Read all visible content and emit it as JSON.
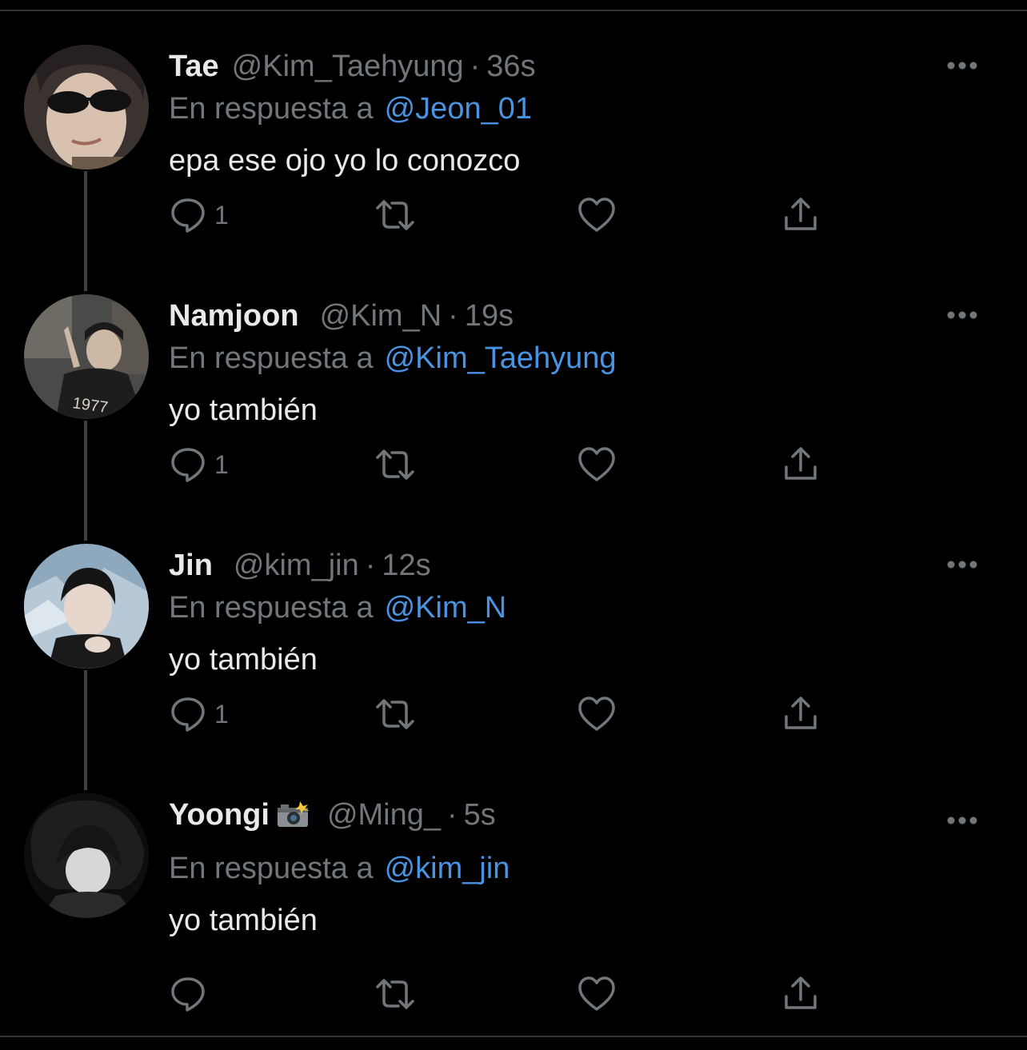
{
  "tweets": [
    {
      "name": "Tae",
      "handle": "@Kim_Taehyung",
      "dot": "·",
      "time": "36s",
      "reply_prefix": "En respuesta a",
      "reply_to": "@Jeon_01",
      "text": "epa ese ojo yo lo conozco",
      "reply_count": "1"
    },
    {
      "name": "Namjoon",
      "handle": "@Kim_N",
      "dot": "·",
      "time": "19s",
      "reply_prefix": "En respuesta a",
      "reply_to": "@Kim_Taehyung",
      "text": "yo también",
      "reply_count": "1"
    },
    {
      "name": "Jin",
      "handle": "@kim_jin",
      "dot": "·",
      "time": "12s",
      "reply_prefix": "En respuesta a",
      "reply_to": "@Kim_N",
      "text": "yo también",
      "reply_count": "1"
    },
    {
      "name": "Yoongi",
      "name_emoji": "camera-with-flash",
      "handle": "@Ming_",
      "dot": "·",
      "time": "5s",
      "reply_prefix": "En respuesta a",
      "reply_to": "@kim_jin",
      "text": "yo también",
      "reply_count": ""
    }
  ],
  "colors": {
    "background": "#000000",
    "primary_text": "#e7e9ea",
    "secondary_text": "#71767b",
    "link": "#4a93e0",
    "thread_line": "#3e4144"
  },
  "icons": [
    "reply-icon",
    "retweet-icon",
    "like-icon",
    "share-icon",
    "more-icon"
  ]
}
